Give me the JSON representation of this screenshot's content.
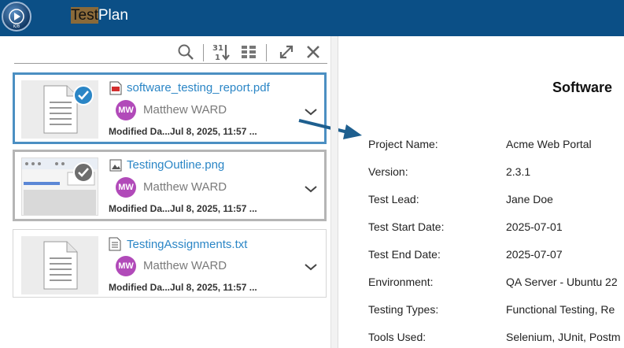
{
  "header": {
    "app_title_prefix": "Test",
    "app_title_suffix": "Plan",
    "header_color": "#0b4f86"
  },
  "toolbar": {
    "icons": [
      "search-icon",
      "sort-icon",
      "view-toggle-icon",
      "expand-icon",
      "close-icon"
    ]
  },
  "files": [
    {
      "name": "software_testing_report.pdf",
      "icon": "pdf-icon",
      "owner_initials": "MW",
      "owner": "Matthew WARD",
      "modified_label": "Modified Da...",
      "modified_value": "Jul 8, 2025, 11:57 ...",
      "state": "selected"
    },
    {
      "name": "TestingOutline.png",
      "icon": "image-icon",
      "owner_initials": "MW",
      "owner": "Matthew WARD",
      "modified_label": "Modified Da...",
      "modified_value": "Jul 8, 2025, 11:57 ...",
      "state": "hovered"
    },
    {
      "name": "TestingAssignments.txt",
      "icon": "text-file-icon",
      "owner_initials": "MW",
      "owner": "Matthew WARD",
      "modified_label": "Modified Da...",
      "modified_value": "Jul 8, 2025, 11:57 ...",
      "state": "normal"
    }
  ],
  "preview": {
    "title": "Software",
    "fields": [
      {
        "label": "Project Name:",
        "value": "Acme Web Portal"
      },
      {
        "label": "Version:",
        "value": "2.3.1"
      },
      {
        "label": "Test Lead:",
        "value": "Jane Doe"
      },
      {
        "label": "Test Start Date:",
        "value": "2025-07-01"
      },
      {
        "label": "Test End Date:",
        "value": "2025-07-07"
      },
      {
        "label": "Environment:",
        "value": "QA Server - Ubuntu 22"
      },
      {
        "label": "Testing Types:",
        "value": "Functional Testing, Re"
      },
      {
        "label": "Tools Used:",
        "value": "Selenium, JUnit, Postm"
      }
    ]
  },
  "colors": {
    "link": "#2b86c6",
    "selected_border": "#4b8fc2",
    "avatar": "#b14ab9",
    "arrow": "#1e5f8f"
  }
}
